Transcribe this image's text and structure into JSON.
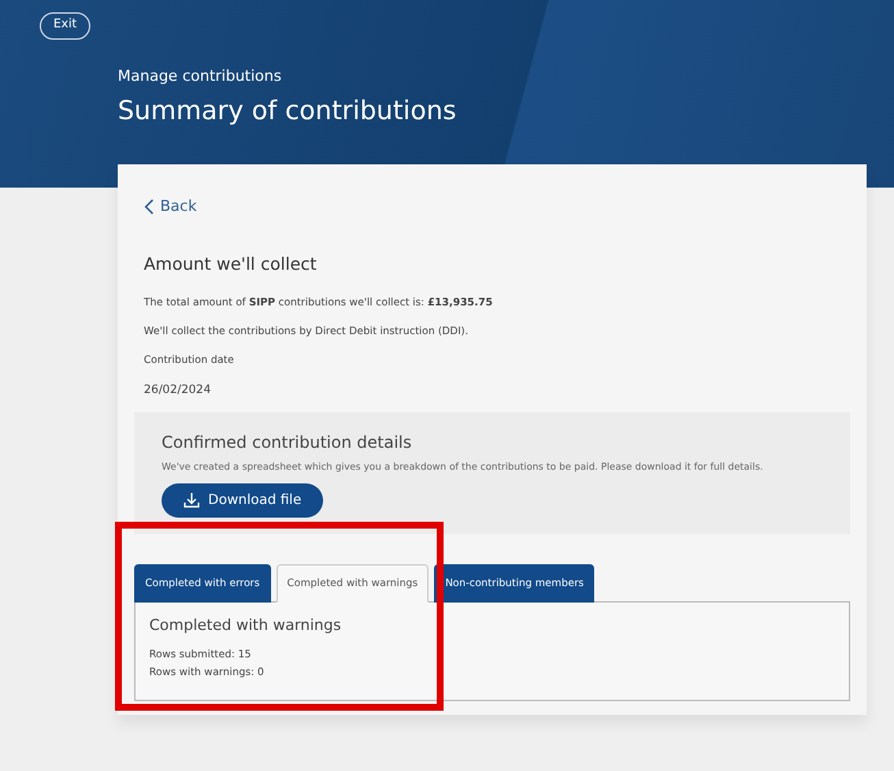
{
  "header": {
    "exit_button": "Exit",
    "subtitle": "Manage contributions",
    "title": "Summary of contributions"
  },
  "back_link": "Back",
  "amount": {
    "heading": "Amount we'll collect",
    "total_text": "The total amount of **SIPP** contributions we'll collect is: **£13,935.75**",
    "ddi_text": "We'll collect the contributions by Direct Debit instruction (DDI).",
    "date_label": "Contribution date",
    "date_value": "26/02/2024"
  },
  "details": {
    "heading": "Confirmed contribution details",
    "text": "We've created a spreadsheet which gives you a breakdown of the contributions to be paid. Please download it for full details.",
    "button": "Download file"
  },
  "tabs": [
    {
      "label": "Completed with errors",
      "selected": false
    },
    {
      "label": "Completed with warnings",
      "selected": true
    },
    {
      "label": "Non-contributing members",
      "selected": false
    }
  ],
  "panel": {
    "heading": "Completed with warnings",
    "lines": [
      "Rows submitted: 15",
      "Rows with warnings: 0"
    ]
  }
}
